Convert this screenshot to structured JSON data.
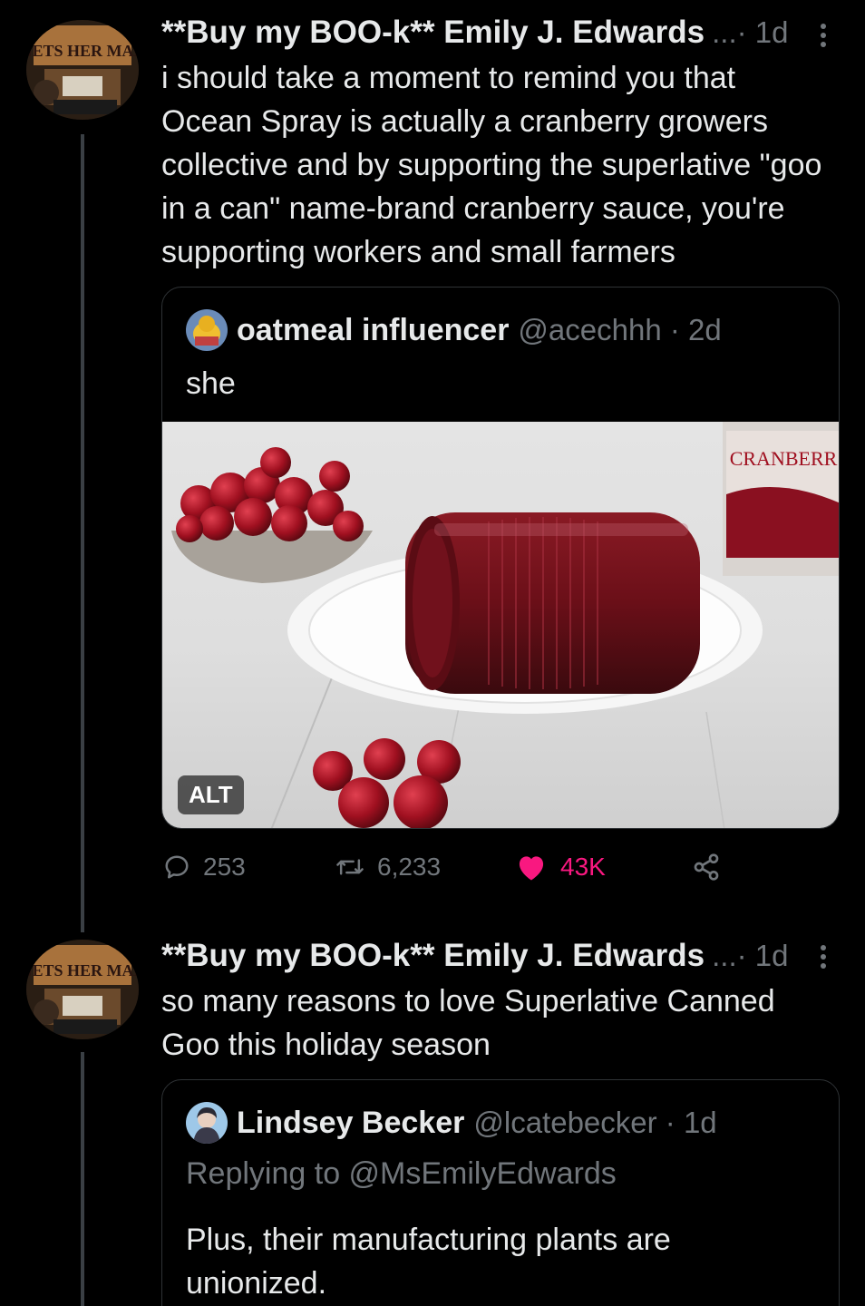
{
  "tweets": [
    {
      "name": "**Buy my BOO-k** Emily J. Edwards",
      "meta": "...· 1d",
      "text": "i should take a moment to remind you that Ocean Spray is actually a cranberry growers collective and by supporting the superlative \"goo in a can\" name-brand cranberry sauce, you're supporting workers and small farmers",
      "quote": {
        "name": "oatmeal influencer",
        "handle": "@acechhh · 2d",
        "text": "she",
        "image_alt_label": "ALT",
        "image_can_label": "CRANBERR"
      },
      "actions": {
        "replies": "253",
        "retweets": "6,233",
        "likes": "43K"
      }
    },
    {
      "name": "**Buy my BOO-k** Emily J. Edwards",
      "meta": "...· 1d",
      "text": "so many reasons to love Superlative Canned Goo this holiday season",
      "quote": {
        "name": "Lindsey Becker",
        "handle": "@lcatebecker · 1d",
        "replying_to": "Replying to @MsEmilyEdwards",
        "text": "Plus, their manufacturing plants are unionized."
      }
    }
  ],
  "avatar_text": "GETS HER MAN",
  "colors": {
    "background": "#000000",
    "text": "#e7e9ea",
    "secondary": "#71767b",
    "border": "#2f3336",
    "like": "#f91880"
  },
  "icons": [
    "reply-icon",
    "retweet-icon",
    "heart-icon",
    "share-icon",
    "more-icon"
  ]
}
